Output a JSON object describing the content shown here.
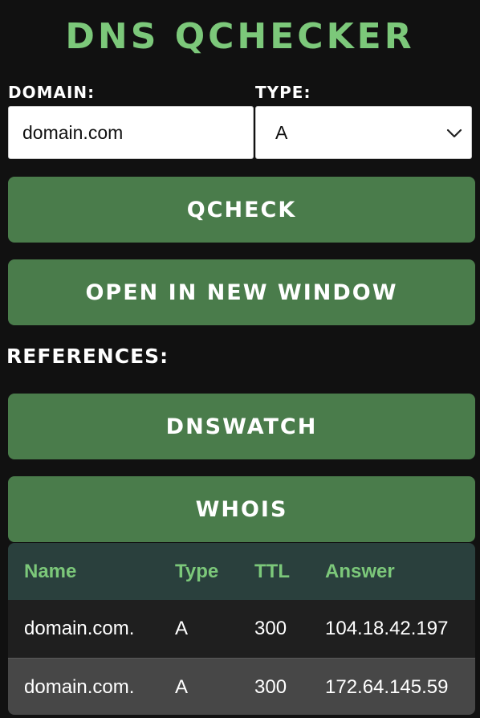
{
  "app": {
    "title": "DNS QCHECKER"
  },
  "form": {
    "domain_label": "DOMAIN:",
    "domain_value": "domain.com",
    "type_label": "TYPE:",
    "type_value": "A"
  },
  "actions": {
    "qcheck_label": "QCHECK",
    "new_window_label": "OPEN IN NEW WINDOW"
  },
  "references": {
    "heading": "REFERENCES:",
    "dnswatch_label": "DNSWATCH",
    "whois_label": "WHOIS"
  },
  "results": {
    "headers": {
      "name": "Name",
      "type": "Type",
      "ttl": "TTL",
      "answer": "Answer"
    },
    "rows": [
      {
        "name": "domain.com.",
        "type": "A",
        "ttl": "300",
        "answer": "104.18.42.197"
      },
      {
        "name": "domain.com.",
        "type": "A",
        "ttl": "300",
        "answer": "172.64.145.59"
      }
    ]
  },
  "colors": {
    "background": "#111111",
    "accent_green": "#7cc87a",
    "button_green": "#4a7c4b",
    "table_header": "#2a403d",
    "row_dark": "#1f1f1f",
    "row_light": "#474747"
  },
  "icons": {
    "select_arrow": "chevron-down-icon"
  }
}
